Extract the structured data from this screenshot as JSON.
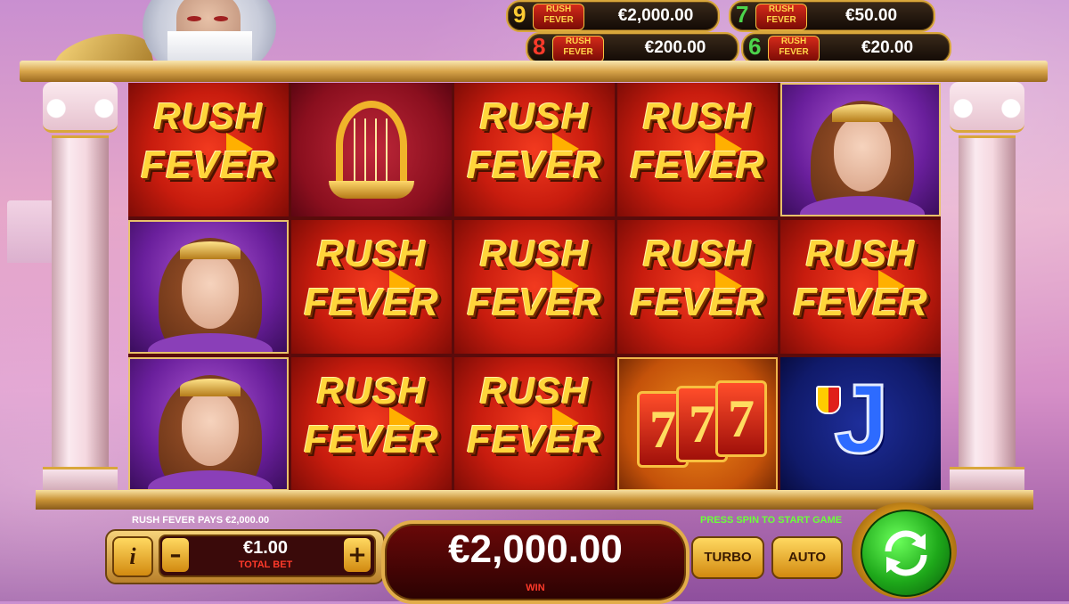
{
  "jackpots": [
    {
      "count": "9",
      "count_color": "#ffcc33",
      "logo_top": "RUSH",
      "logo_bottom": "FEVER",
      "amount": "€2,000.00"
    },
    {
      "count": "7",
      "count_color": "#4cd44c",
      "logo_top": "RUSH",
      "logo_bottom": "FEVER",
      "amount": "€50.00"
    },
    {
      "count": "8",
      "count_color": "#ff3a2a",
      "logo_top": "RUSH",
      "logo_bottom": "FEVER",
      "amount": "€200.00"
    },
    {
      "count": "6",
      "count_color": "#4cd44c",
      "logo_top": "RUSH",
      "logo_bottom": "FEVER",
      "amount": "€20.00"
    }
  ],
  "reels": {
    "symbols": [
      [
        "rush-fever",
        "lady",
        "lady"
      ],
      [
        "lyre",
        "rush-fever",
        "rush-fever"
      ],
      [
        "rush-fever",
        "rush-fever",
        "rush-fever"
      ],
      [
        "rush-fever",
        "rush-fever",
        "triple-seven"
      ],
      [
        "lady",
        "rush-fever",
        "jack"
      ]
    ],
    "rush_line1": "RUSH",
    "rush_line2": "FEVER",
    "jack_letter": "J",
    "seven_glyph": "7"
  },
  "status": {
    "pays_text": "RUSH FEVER PAYS €2,000.00",
    "hint_text": "PRESS SPIN TO START GAME"
  },
  "controls": {
    "info_label": "i",
    "minus_label": "–",
    "plus_label": "+",
    "bet_value": "€1.00",
    "bet_label": "TOTAL BET",
    "win_value": "€2,000.00",
    "win_label": "WIN",
    "turbo_label": "TURBO",
    "auto_label": "AUTO"
  },
  "colors": {
    "gold": "#e2ad4a",
    "win_label": "#ff3a2a",
    "hint_green": "#6bff3a",
    "spin_green": "#1ea81a"
  }
}
